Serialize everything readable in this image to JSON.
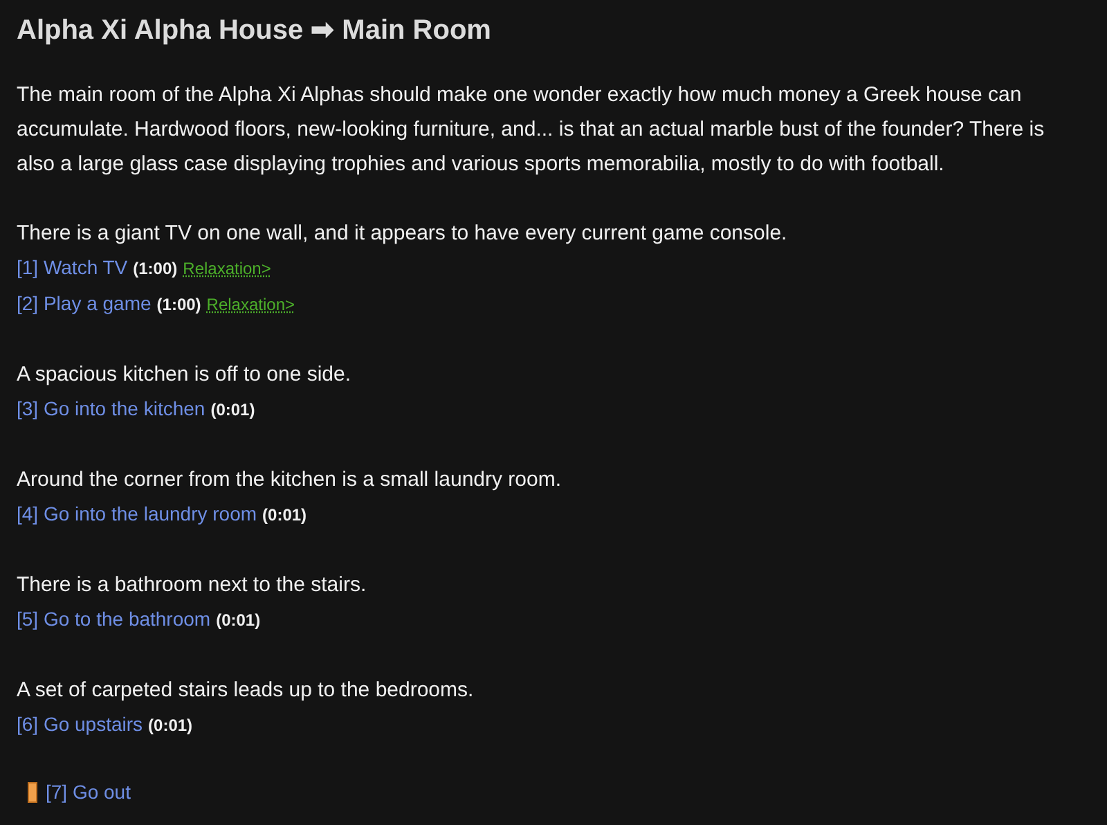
{
  "title": "Alpha Xi Alpha House ➡ Main Room",
  "sections": [
    {
      "text": "The main room of the Alpha Xi Alphas should make one wonder exactly how much money a Greek house can accumulate. Hardwood floors, new-looking furniture, and... is that an actual marble bust of the founder? There is also a large glass case displaying trophies and various sports memorabilia, mostly to do with football."
    },
    {
      "text": "There is a giant TV on one wall, and it appears to have every current game console.",
      "actions": [
        {
          "label": "[1] Watch TV",
          "time": "(1:00)",
          "tag": "Relaxation>"
        },
        {
          "label": "[2] Play a game",
          "time": "(1:00)",
          "tag": "Relaxation>"
        }
      ]
    },
    {
      "text": "A spacious kitchen is off to one side.",
      "actions": [
        {
          "label": "[3] Go into the kitchen",
          "time": "(0:01)"
        }
      ]
    },
    {
      "text": "Around the corner from the kitchen is a small laundry room.",
      "actions": [
        {
          "label": "[4] Go into the laundry room",
          "time": "(0:01)"
        }
      ]
    },
    {
      "text": "There is a bathroom next to the stairs.",
      "actions": [
        {
          "label": "[5] Go to the bathroom",
          "time": "(0:01)"
        }
      ]
    },
    {
      "text": "A set of carpeted stairs leads up to the bedrooms.",
      "actions": [
        {
          "label": "[6] Go upstairs",
          "time": "(0:01)"
        }
      ]
    }
  ],
  "exit": {
    "label": "[7] Go out"
  }
}
